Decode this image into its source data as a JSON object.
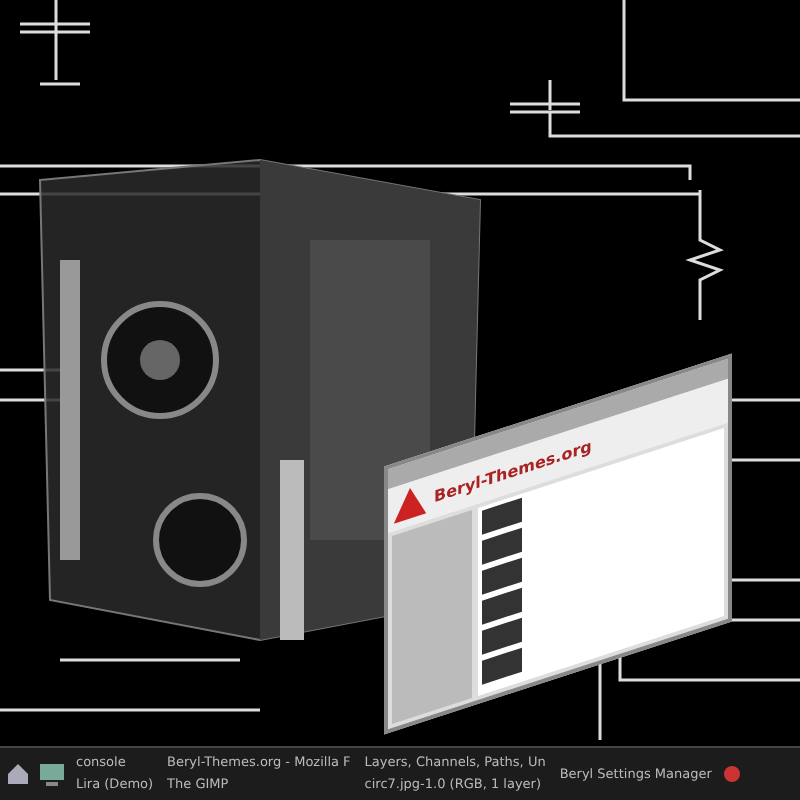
{
  "browser_window": {
    "site_title": "Beryl-Themes.org"
  },
  "taskbar": {
    "windows": [
      {
        "title": "console"
      },
      {
        "title": "Lira (Demo)"
      },
      {
        "title": "Beryl-Themes.org - Mozilla F"
      },
      {
        "title": "The GIMP"
      },
      {
        "title": "Layers, Channels, Paths, Un"
      },
      {
        "title": "circ7.jpg-1.0 (RGB, 1 layer)"
      },
      {
        "title": "Beryl Settings Manager"
      }
    ]
  }
}
